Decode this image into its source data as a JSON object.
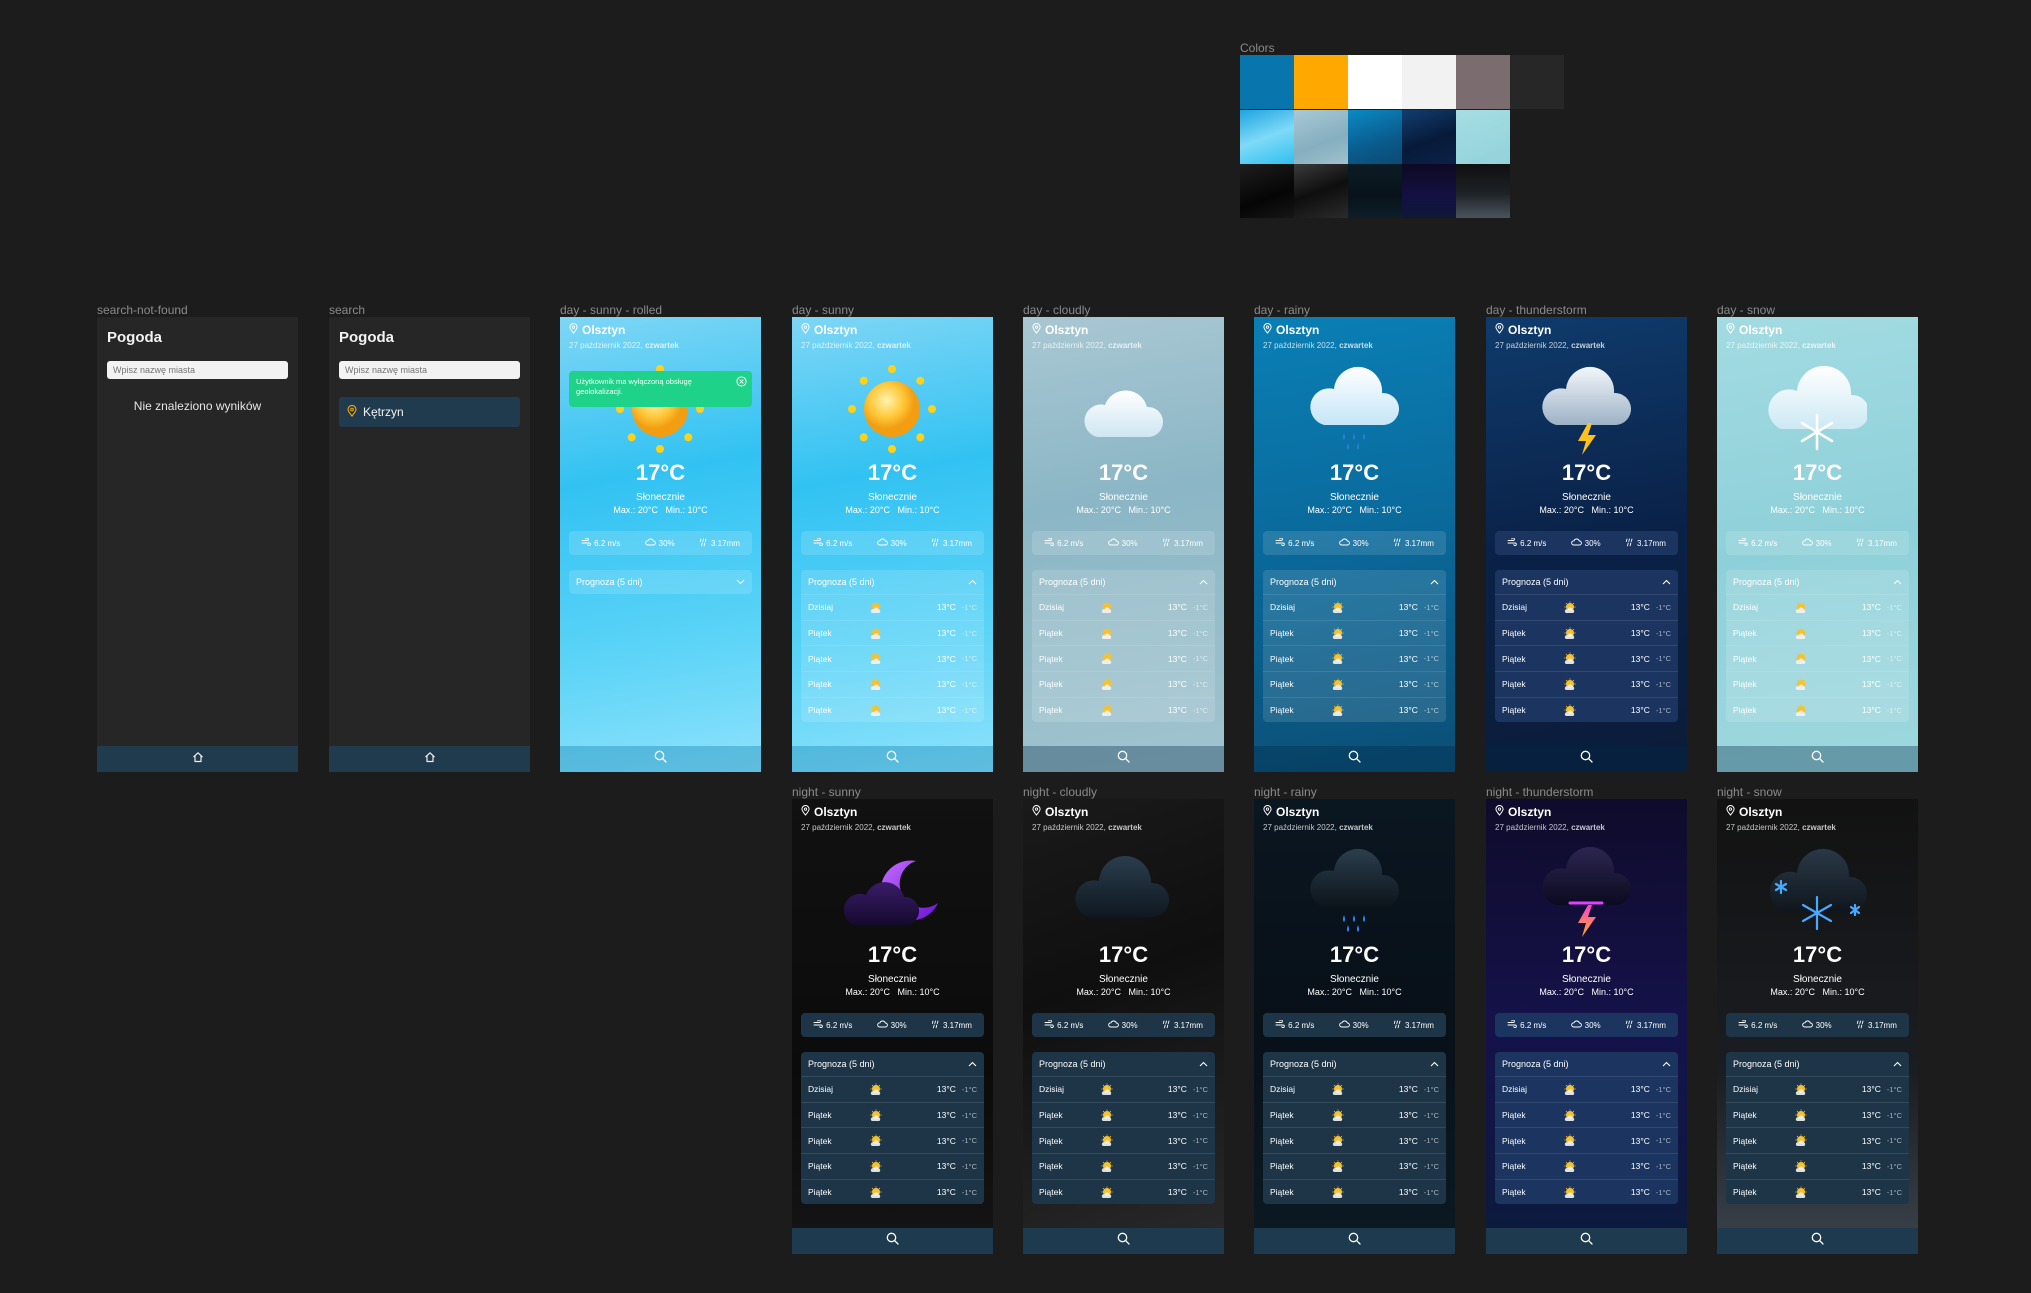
{
  "palette": {
    "title": "Colors",
    "swatches": [
      "#0876ad",
      "#ffa900",
      "#ffffff",
      "#f2f2f2",
      "#7a6c6f",
      "#272727",
      "#3fc5f0",
      "#8fb8c6",
      "#0b6da3",
      "#0a2d59",
      "#a8d9e0",
      "#0f0f0f",
      "#2a2a2a",
      "#0b1a22",
      "#131027",
      "#3b4047"
    ]
  },
  "common": {
    "app_title": "Pogoda",
    "search_placeholder": "Wpisz nazwę miasta",
    "no_results": "Nie znaleziono wyników",
    "result_city": "Kętrzyn",
    "city": "Olsztyn",
    "date": "27 październik 2022,",
    "weekday": "czwartek",
    "temperature": "17°C",
    "condition": "Słonecznie",
    "max": "Max.: 20°C",
    "min": "Min.: 10°C",
    "wind": "6.2 m/s",
    "clouds": "30%",
    "rain": "3.17mm",
    "forecast_title": "Prognoza (5 dni)",
    "toast": "Użytkownik ma wyłączoną obsługę geolokalizacji.",
    "forecast": [
      {
        "day": "Dzisiaj",
        "hi": "13°C",
        "lo": "-1°C"
      },
      {
        "day": "Piątek",
        "hi": "13°C",
        "lo": "-1°C"
      },
      {
        "day": "Piątek",
        "hi": "13°C",
        "lo": "-1°C"
      },
      {
        "day": "Piątek",
        "hi": "13°C",
        "lo": "-1°C"
      },
      {
        "day": "Piątek",
        "hi": "13°C",
        "lo": "-1°C"
      }
    ]
  },
  "frames": {
    "search_not_found": "search-not-found",
    "search": "search",
    "day_sunny_rolled": "day - sunny - rolled",
    "day_sunny": "day - sunny",
    "day_cloudy": "day - cloudly",
    "day_rainy": "day - rainy",
    "day_storm": "day - thunderstorm",
    "day_snow": "day - snow",
    "night_sunny": "night - sunny",
    "night_cloudy": "night - cloudly",
    "night_rainy": "night - rainy",
    "night_storm": "night - thunderstorm",
    "night_snow": "night - snow"
  }
}
